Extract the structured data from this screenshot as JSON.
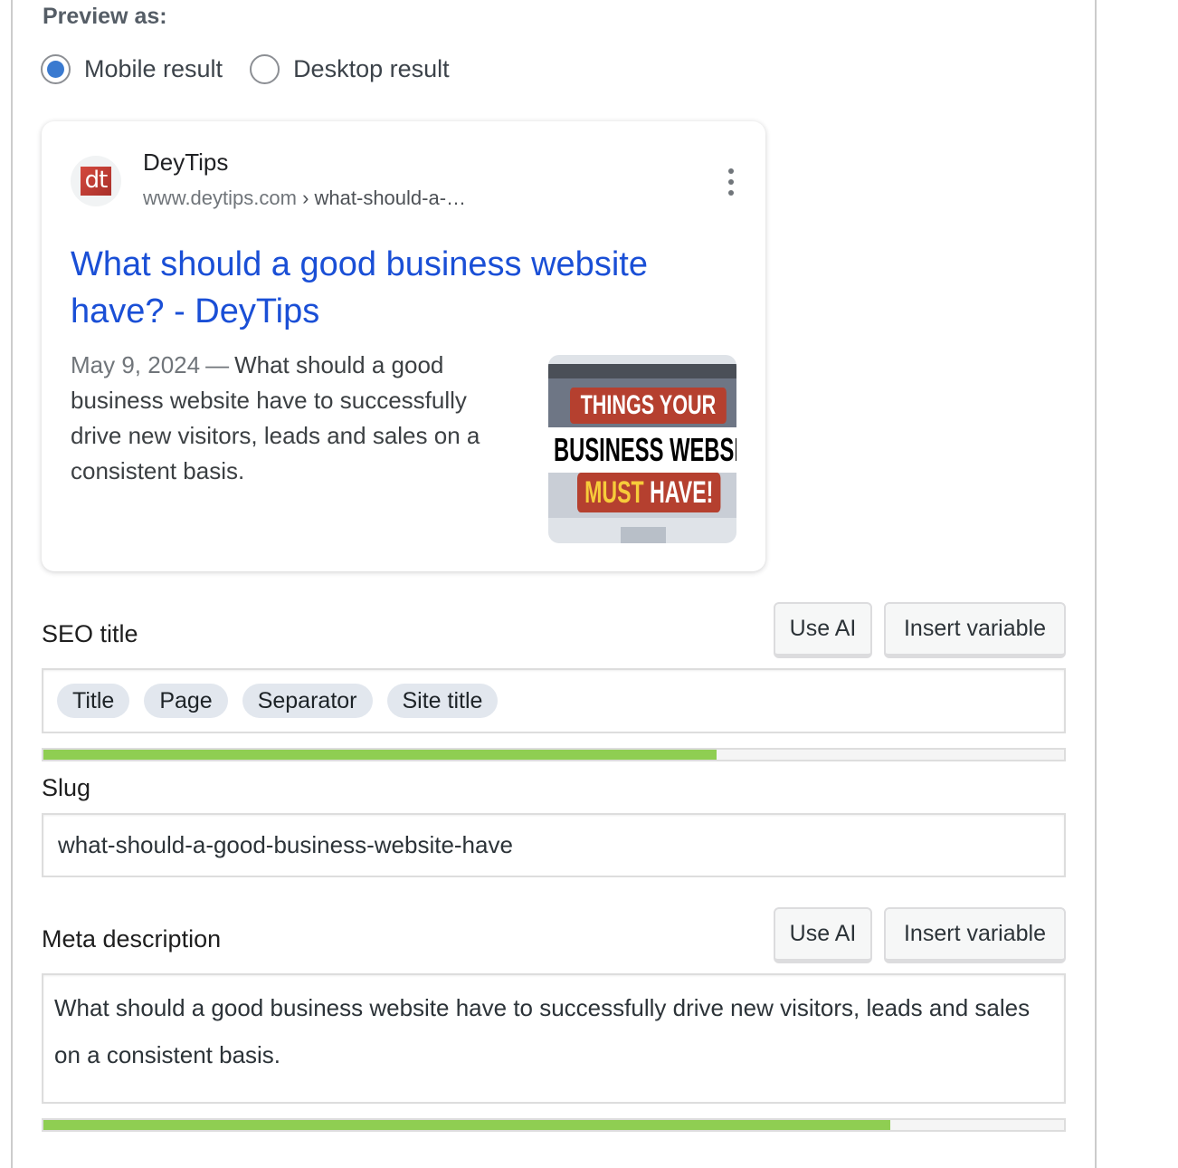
{
  "preview": {
    "label": "Preview as:",
    "options": [
      {
        "label": "Mobile result",
        "selected": true
      },
      {
        "label": "Desktop result",
        "selected": false
      }
    ]
  },
  "serp": {
    "favicon_text": "dt",
    "site_name": "DeyTips",
    "url_domain": "www.deytips.com",
    "url_separator": " › ",
    "url_path": "what-should-a-…",
    "title": "What should a good business website have? - DeyTips",
    "date": "May 9, 2024",
    "dash": "—",
    "description": "What should a good business website have to successfully drive new visitors, leads and sales on a consistent basis.",
    "thumbnail": {
      "line1": "THINGS YOUR",
      "line2": "BUSINESS WEBSIT",
      "line3_yellow": "MUST",
      "line3_white": "HAVE!"
    },
    "more_icon": "kebab-menu-icon"
  },
  "seo_title": {
    "label": "SEO title",
    "use_ai_label": "Use AI",
    "insert_variable_label": "Insert variable",
    "chips": [
      "Title",
      "Page",
      "Separator",
      "Site title"
    ],
    "progress": 0.66
  },
  "slug": {
    "label": "Slug",
    "value": "what-should-a-good-business-website-have"
  },
  "meta_description": {
    "label": "Meta description",
    "use_ai_label": "Use AI",
    "insert_variable_label": "Insert variable",
    "value": "What should a good business website have to successfully drive new visitors, leads and sales on a consistent basis.",
    "progress": 0.83
  },
  "colors": {
    "link_blue": "#1a4fd6",
    "progress_green": "#8fce52",
    "radio_blue": "#3a7ad0"
  }
}
